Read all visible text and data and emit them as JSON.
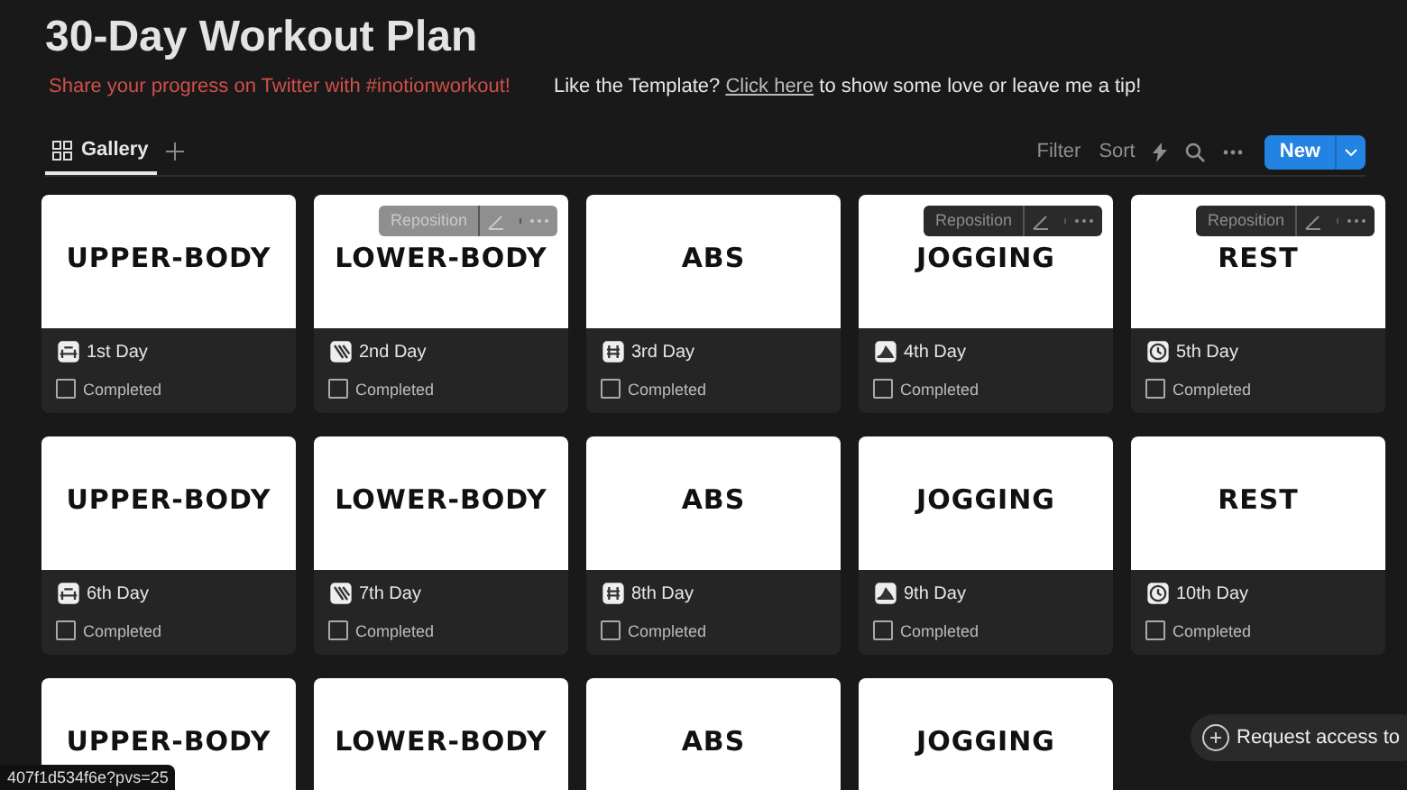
{
  "title": "30-Day Workout Plan",
  "share_text": "Share your progress on Twitter with #inotionworkout!",
  "tip": {
    "before": "Like the Template? ",
    "link": "Click here",
    "after": " to show some love or leave me a tip!"
  },
  "tabs": [
    {
      "label": "Gallery",
      "selected": true
    }
  ],
  "toolbar": {
    "filter": "Filter",
    "sort": "Sort",
    "new_button": "New"
  },
  "cards": [
    {
      "cover": "UPPER-BODY",
      "name": "1st Day",
      "checkbox_label": "Completed",
      "checked": false
    },
    {
      "cover": "LOWER-BODY",
      "name": "2nd Day",
      "checkbox_label": "Completed",
      "checked": false,
      "cover_toolbar": {
        "label": "Reposition",
        "dim": true
      }
    },
    {
      "cover": "ABS",
      "name": "3rd Day",
      "checkbox_label": "Completed",
      "checked": false
    },
    {
      "cover": "JOGGING",
      "name": "4th Day",
      "checkbox_label": "Completed",
      "checked": false,
      "cover_toolbar": {
        "label": "Reposition",
        "dim": false
      }
    },
    {
      "cover": "REST",
      "name": "5th Day",
      "checkbox_label": "Completed",
      "checked": false,
      "cover_toolbar": {
        "label": "Reposition",
        "dim": false
      }
    },
    {
      "cover": "UPPER-BODY",
      "name": "6th Day",
      "checkbox_label": "Completed",
      "checked": false
    },
    {
      "cover": "LOWER-BODY",
      "name": "7th Day",
      "checkbox_label": "Completed",
      "checked": false
    },
    {
      "cover": "ABS",
      "name": "8th Day",
      "checkbox_label": "Completed",
      "checked": false
    },
    {
      "cover": "JOGGING",
      "name": "9th Day",
      "checkbox_label": "Completed",
      "checked": false
    },
    {
      "cover": "REST",
      "name": "10th Day",
      "checkbox_label": "Completed",
      "checked": false
    },
    {
      "cover": "UPPER-BODY"
    },
    {
      "cover": "LOWER-BODY"
    },
    {
      "cover": "ABS"
    },
    {
      "cover": "JOGGING"
    }
  ],
  "status_url": "407f1d534f6e?pvs=25",
  "request_popup": "Request access to"
}
